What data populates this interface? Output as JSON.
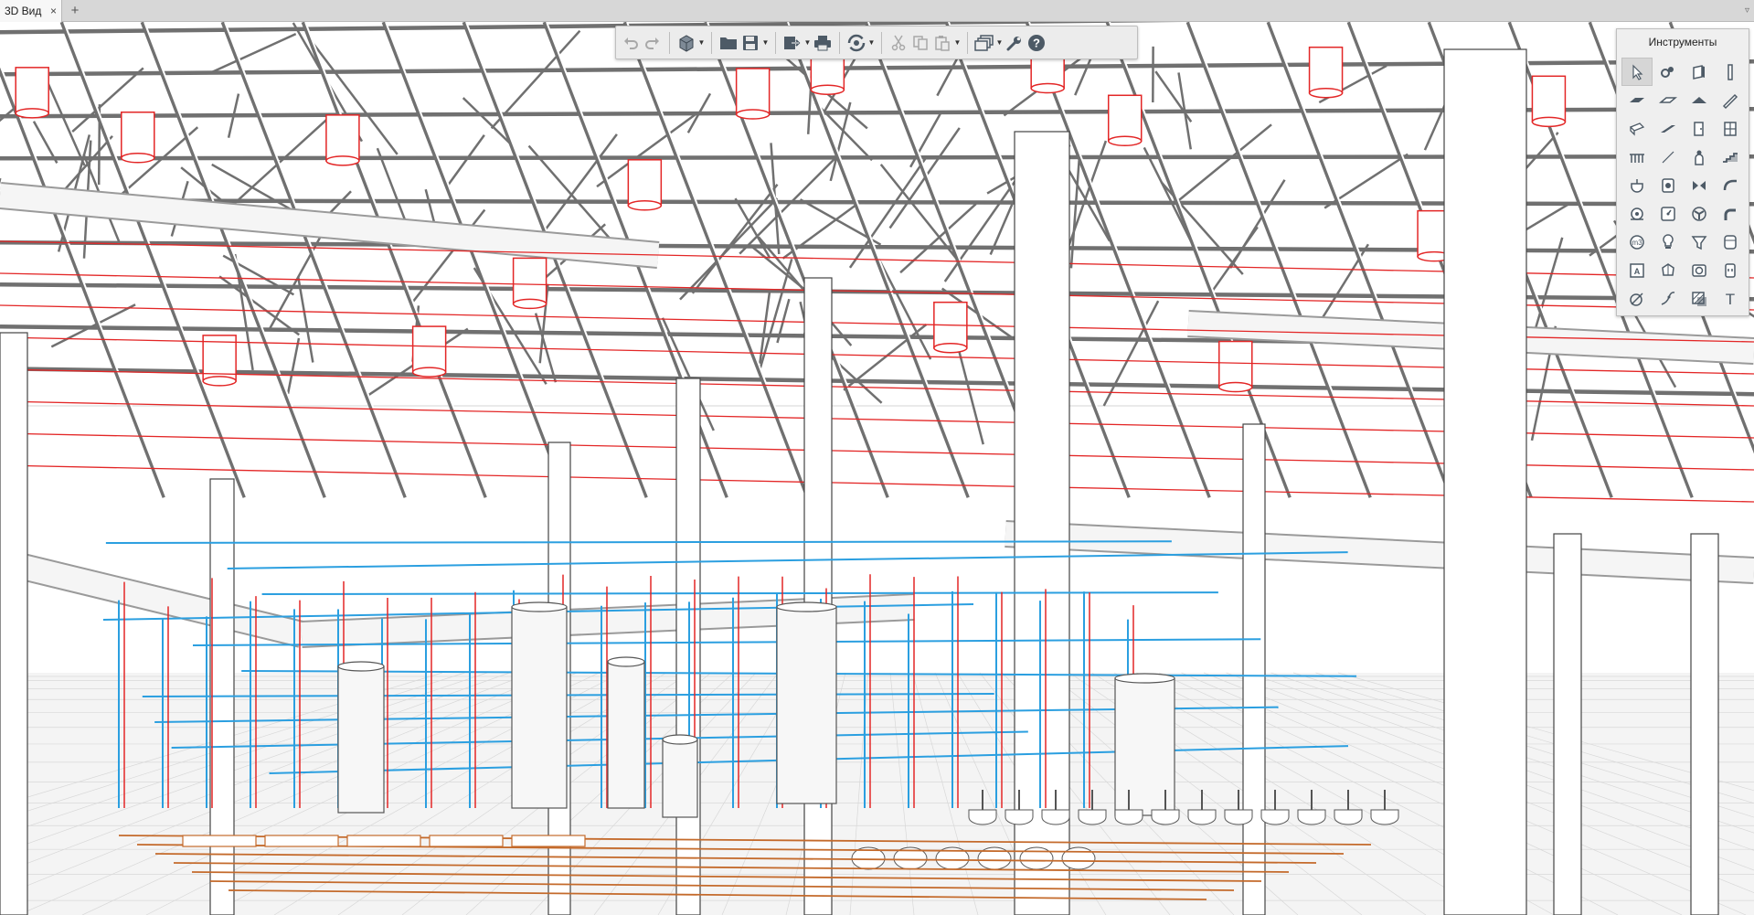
{
  "tabs": [
    {
      "label": "3D Вид",
      "close": "×",
      "active": true
    }
  ],
  "new_tab_label": "+",
  "tab_menu_glyph": "▿",
  "toolbar": {
    "buttons": [
      {
        "name": "undo-button",
        "icon": "undo-icon",
        "enabled": false
      },
      {
        "name": "redo-button",
        "icon": "redo-icon",
        "enabled": false
      },
      {
        "name": "views-button",
        "icon": "cube-icon",
        "dropdown": true
      },
      {
        "name": "open-button",
        "icon": "folder-icon"
      },
      {
        "name": "save-button",
        "icon": "floppy-icon",
        "dropdown": true
      },
      {
        "name": "export-button",
        "icon": "export-icon",
        "dropdown": true
      },
      {
        "name": "print-button",
        "icon": "printer-icon"
      },
      {
        "name": "sync-button",
        "icon": "sync-icon",
        "dropdown": true
      },
      {
        "name": "cut-button",
        "icon": "scissors-icon",
        "enabled": false
      },
      {
        "name": "copy-button",
        "icon": "copy-icon",
        "enabled": false
      },
      {
        "name": "paste-button",
        "icon": "paste-icon",
        "dropdown": true,
        "enabled": false
      },
      {
        "name": "windows-button",
        "icon": "windows-icon",
        "dropdown": true
      },
      {
        "name": "settings-button",
        "icon": "wrench-icon"
      },
      {
        "name": "help-button",
        "icon": "help-icon"
      }
    ]
  },
  "palette": {
    "title": "Инструменты",
    "tools": [
      "cursor-icon",
      "pipe-fitting-icon",
      "wall-icon",
      "column-icon",
      "slab-icon",
      "floor-icon",
      "roof-icon",
      "beam-icon",
      "duct-icon",
      "ramp-icon",
      "door-icon",
      "window-icon",
      "railing-icon",
      "line-icon",
      "person-icon",
      "stair-icon",
      "sink-icon",
      "boiler-icon",
      "valve-icon",
      "hose-icon",
      "pump-icon",
      "gauge-icon",
      "fan-icon",
      "elbow-icon",
      "meter-icon",
      "lamp-icon",
      "filter-icon",
      "tank-icon",
      "panel-icon",
      "sprinkler-icon",
      "camera-icon",
      "socket-icon",
      "dimension-icon",
      "level-icon",
      "hatch-icon",
      "text-icon"
    ],
    "active_index": 0,
    "text_tool_glyph": "T"
  },
  "scene": {
    "colors": {
      "structure": "#707070",
      "fire_pipes": "#e32626",
      "water_pipes": "#2b9fe0",
      "sewer_pipes": "#c46a2b",
      "ducts": "#9a9a9a",
      "floor_grid": "#d8d8d8"
    }
  }
}
